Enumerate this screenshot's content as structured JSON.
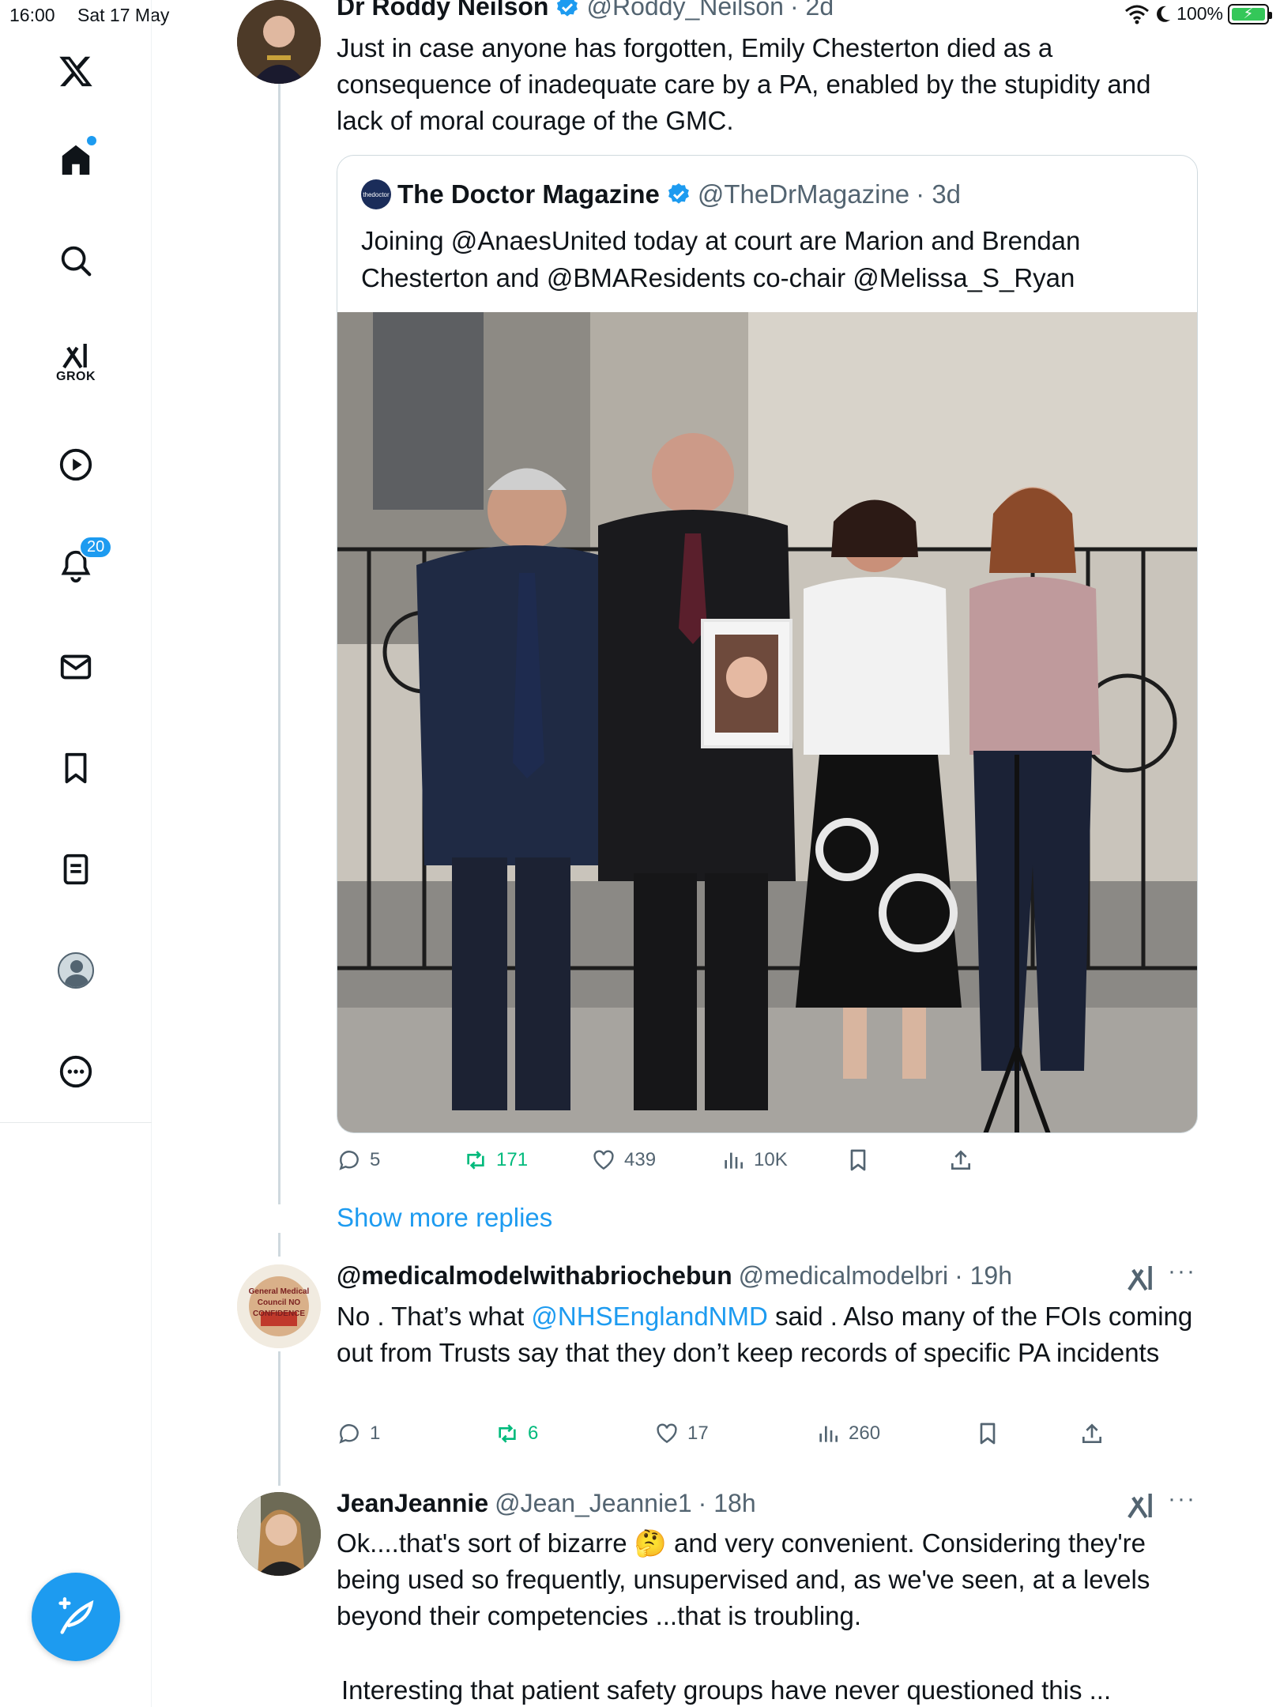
{
  "status_bar": {
    "time": "16:00",
    "date": "Sat 17 May",
    "battery": "100%"
  },
  "sidebar": {
    "grok_label": "GROK",
    "notification_count": "20"
  },
  "posts": [
    {
      "name": "Dr Roddy Neilson",
      "handle": "@Roddy_Neilson",
      "time": "· 2d",
      "text": "Just in case anyone has forgotten, Emily Chesterton died as a consequence of inadequate care by a PA, enabled by the stupidity and lack of moral courage of the GMC.",
      "quote": {
        "logo_text": "thedoctor",
        "name": "The Doctor Magazine",
        "handle": "@TheDrMagazine",
        "time": "· 3d",
        "text": "Joining @AnaesUnited today at court are Marion and Brendan Chesterton and @BMAResidents co-chair @Melissa_S_Ryan"
      },
      "stats": {
        "replies": "5",
        "reposts": "171",
        "likes": "439",
        "views": "10K"
      }
    },
    {
      "name": "@medicalmodelwithabriochebun",
      "handle": "@medicalmodelbri",
      "time": "· 19h",
      "avatar_text": "General Medical Council NO CONFIDENCE",
      "text_before": "No . That’s what ",
      "text_mention": "@NHSEnglandNMD",
      "text_after": " said . Also many of the FOIs coming out from Trusts say that they don’t keep records of specific PA incidents",
      "stats": {
        "replies": "1",
        "reposts": "6",
        "likes": "17",
        "views": "260"
      }
    },
    {
      "name": "JeanJeannie",
      "handle": "@Jean_Jeannie1",
      "time": "· 18h",
      "text_before": "Ok....that's sort of bizarre ",
      "text_emoji": "🤔",
      "text_after": " and very convenient. Considering they're being used so frequently,  unsupervised and, as we've seen, at a levels beyond their competencies ...that is troubling.",
      "text_2": "Interesting that patient safety groups have never questioned this ..."
    }
  ],
  "show_more_replies": "Show more replies",
  "colors": {
    "accent": "#1d9bf0",
    "repost_green": "#00ba7c",
    "secondary_text": "#536471"
  }
}
